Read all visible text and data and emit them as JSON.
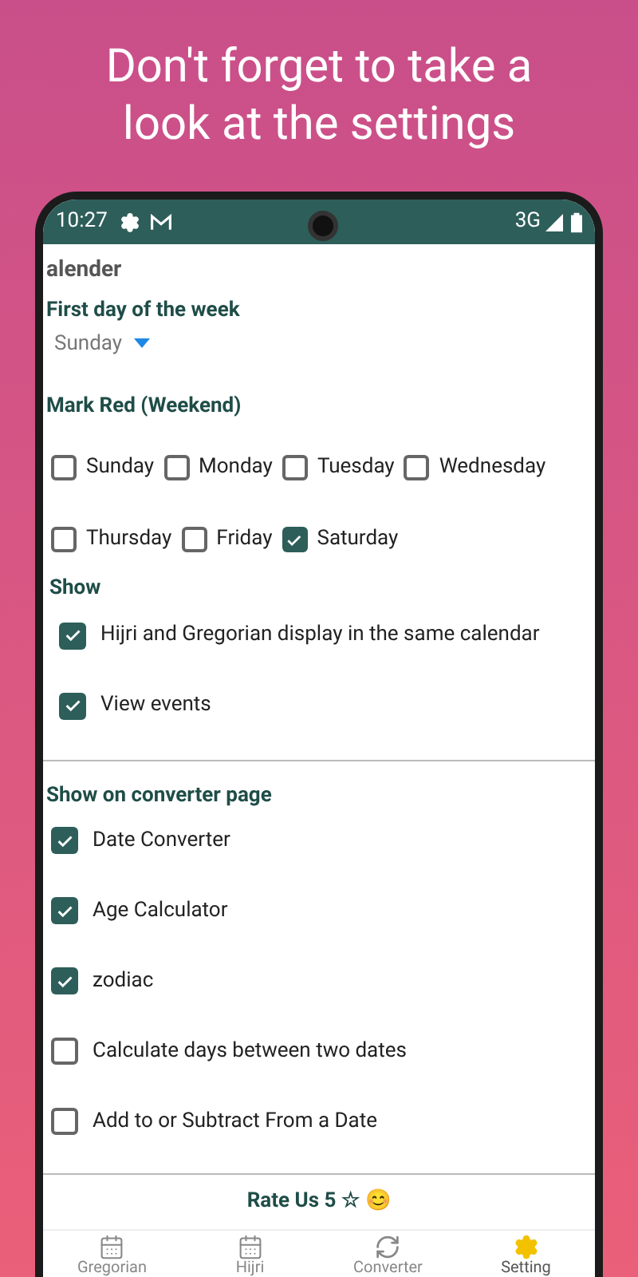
{
  "headline": "Don't forget to take a look at the settings",
  "status_bar": {
    "time": "10:27",
    "network": "3G"
  },
  "calendar_heading": "alender",
  "first_day": {
    "label": "First day of the week",
    "value": "Sunday"
  },
  "mark_red": {
    "label": "Mark Red (Weekend)",
    "days": [
      {
        "label": "Sunday",
        "checked": false
      },
      {
        "label": "Monday",
        "checked": false
      },
      {
        "label": "Tuesday",
        "checked": false
      },
      {
        "label": "Wednesday",
        "checked": false
      },
      {
        "label": "Thursday",
        "checked": false
      },
      {
        "label": "Friday",
        "checked": false
      },
      {
        "label": "Saturday",
        "checked": true
      }
    ]
  },
  "show": {
    "label": "Show",
    "options": [
      {
        "label": "Hijri and Gregorian display in the same calendar",
        "checked": true
      },
      {
        "label": "View events",
        "checked": true
      }
    ]
  },
  "converter_page": {
    "label": "Show on converter page",
    "options": [
      {
        "label": "Date Converter",
        "checked": true
      },
      {
        "label": "Age Calculator",
        "checked": true
      },
      {
        "label": "zodiac",
        "checked": true
      },
      {
        "label": "Calculate days between two dates",
        "checked": false
      },
      {
        "label": "Add to or Subtract From a Date",
        "checked": false
      }
    ]
  },
  "rate_button": "Rate Us 5 ☆ 😊",
  "bottom_nav": [
    {
      "label": "Gregorian",
      "kind": "calendar",
      "selected": false
    },
    {
      "label": "Hijri",
      "kind": "calendar",
      "selected": false
    },
    {
      "label": "Converter",
      "kind": "converter",
      "selected": false
    },
    {
      "label": "Setting",
      "kind": "settings",
      "selected": true
    }
  ]
}
